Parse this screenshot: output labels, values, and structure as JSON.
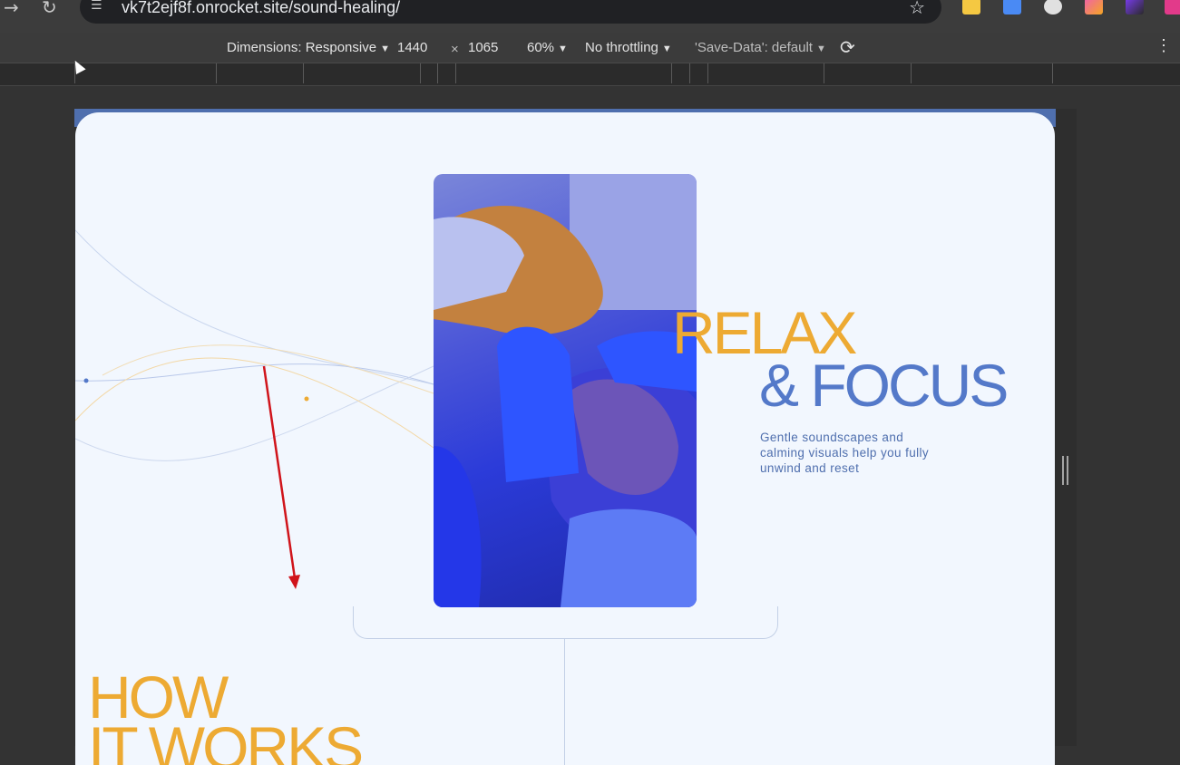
{
  "browser": {
    "url": "vk7t2ejf8f.onrocket.site/sound-healing/"
  },
  "devtools": {
    "dimensions_label": "Dimensions: Responsive",
    "width": "1440",
    "times": "×",
    "height": "1065",
    "zoom": "60%",
    "throttling": "No throttling",
    "save_data": "'Save-Data': default"
  },
  "hero": {
    "title_line1": "RELAX",
    "title_line2": "& FOCUS",
    "tagline": "Gentle soundscapes and calming visuals help you fully unwind and reset"
  },
  "section": {
    "heading_line1": "HOW",
    "heading_line2": "IT WORKS"
  },
  "colors": {
    "accent_orange": "#edaa33",
    "accent_blue": "#5479c9",
    "page_bg": "#f2f7fe",
    "annotation_red": "#d0141b"
  }
}
